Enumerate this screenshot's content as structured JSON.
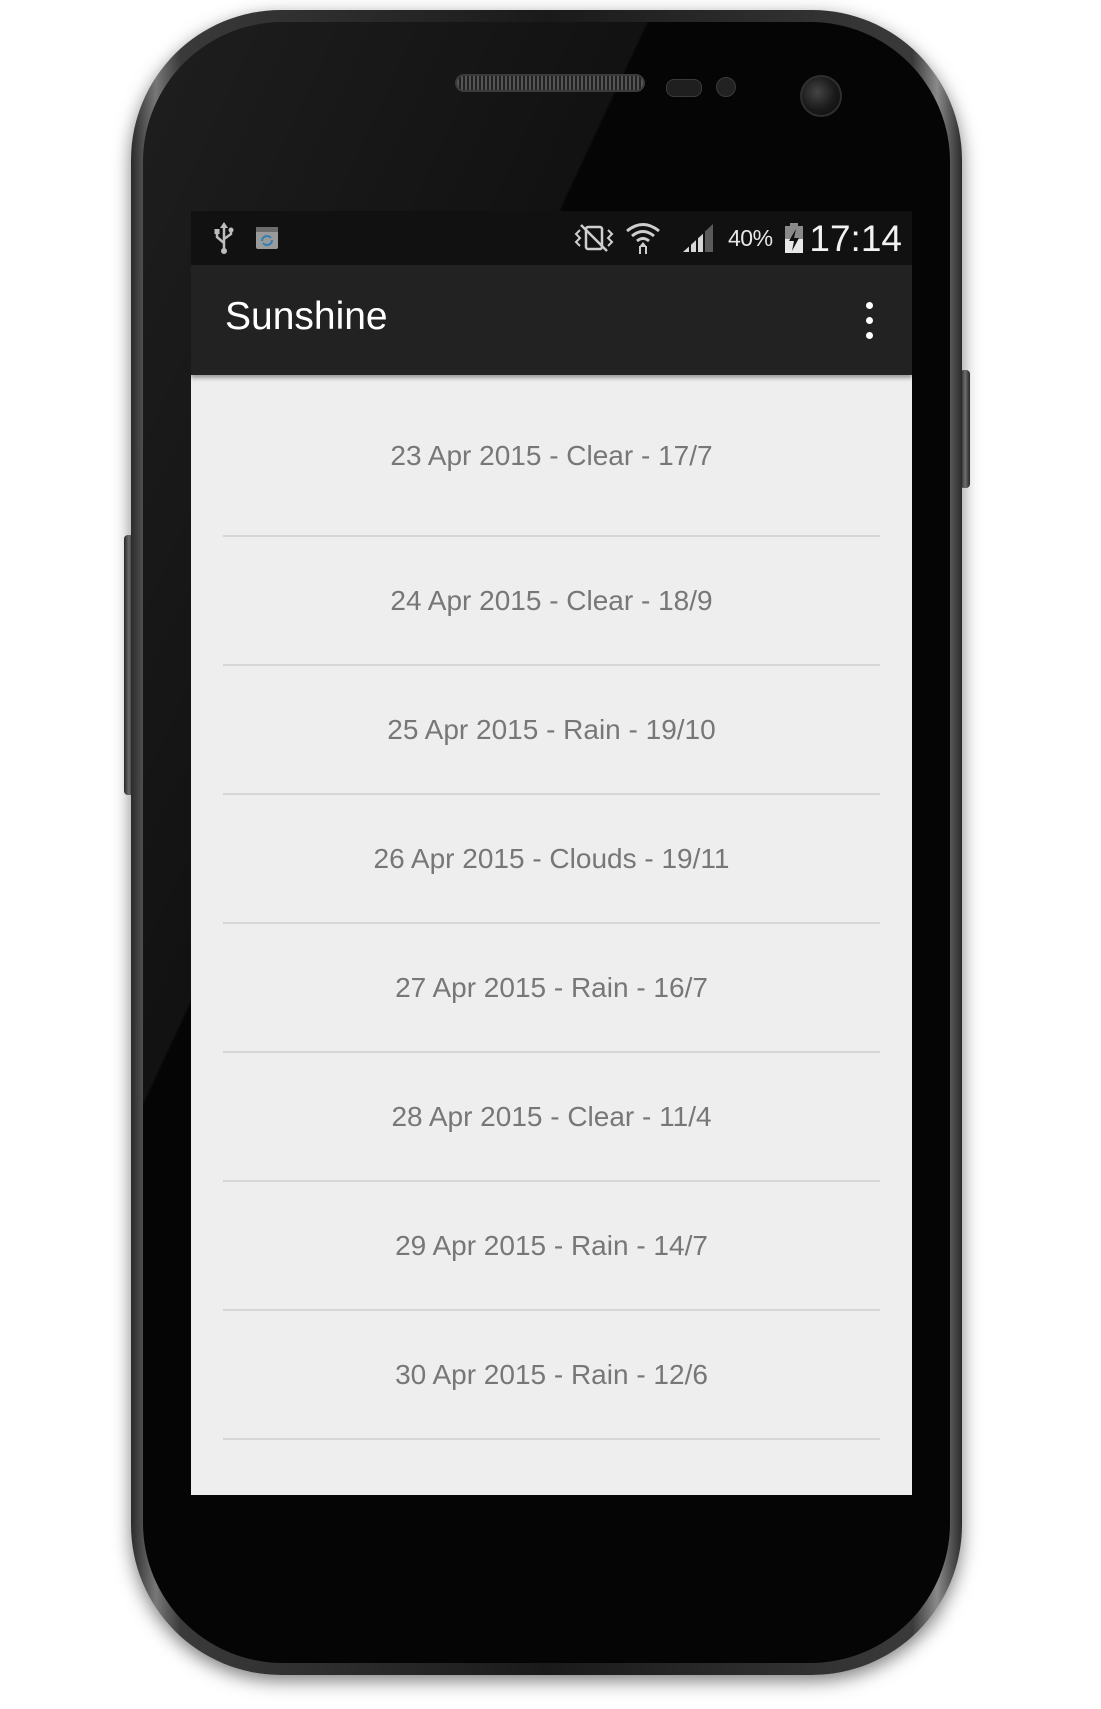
{
  "status_bar": {
    "icons": [
      "usb-icon",
      "sync-notification-icon",
      "vibrate-icon",
      "wifi-icon",
      "signal-icon",
      "battery-charging-icon"
    ],
    "battery_percent": "40%",
    "time": "17:14"
  },
  "action_bar": {
    "title": "Sunshine",
    "overflow_icon": "overflow-menu-icon"
  },
  "forecast": [
    "23 Apr 2015 - Clear - 17/7",
    "24 Apr 2015 - Clear - 18/9",
    "25 Apr 2015 - Rain - 19/10",
    "26 Apr 2015 - Clouds - 19/11",
    "27 Apr 2015 - Rain - 16/7",
    "28 Apr 2015 - Clear - 11/4",
    "29 Apr 2015 - Rain - 14/7",
    "30 Apr 2015 - Rain - 12/6"
  ],
  "colors": {
    "action_bar": "#222222",
    "status_bar": "#111111",
    "list_background": "#eeeeee",
    "list_text": "#777777",
    "divider": "#d6d6d6"
  }
}
